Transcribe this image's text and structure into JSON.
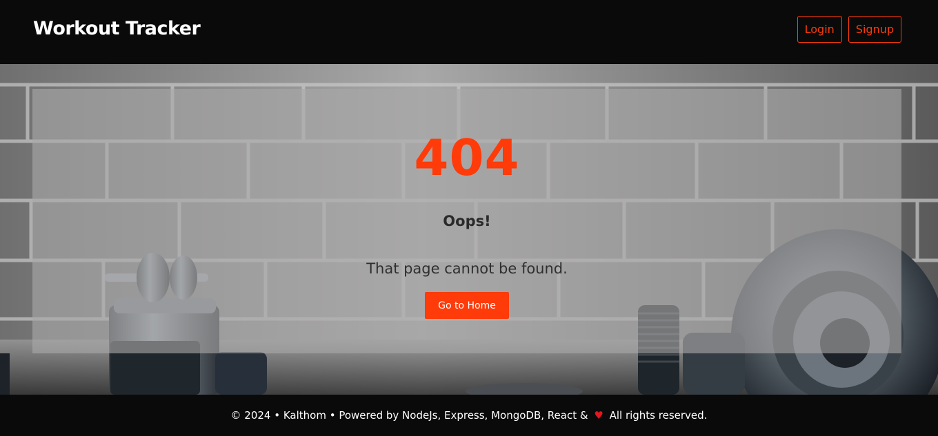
{
  "header": {
    "brand": "Workout Tracker",
    "login_label": "Login",
    "signup_label": "Signup"
  },
  "error": {
    "code": "404",
    "title": "Oops!",
    "message": "That page cannot be found.",
    "home_label": "Go to Home"
  },
  "footer": {
    "text_before": "© 2024 • Kalthom • Powered by NodeJs, Express, MongoDB, React &",
    "heart_icon": "♥",
    "text_after": "All rights reserved."
  },
  "colors": {
    "accent": "#ff3b0a",
    "background": "#0a0a0a",
    "heart": "#e8141c"
  }
}
